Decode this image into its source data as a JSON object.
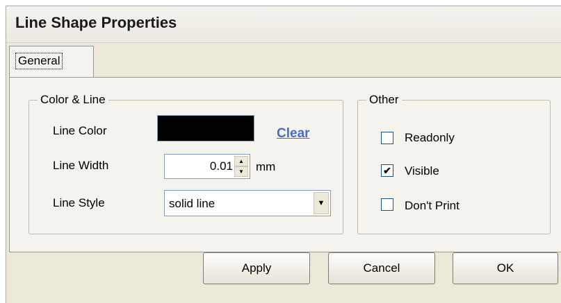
{
  "dialog": {
    "title": "Line Shape Properties"
  },
  "tabs": [
    {
      "label": "General",
      "selected": true
    }
  ],
  "color_line": {
    "legend": "Color & Line",
    "line_color_label": "Line Color",
    "line_color_value": "#000000",
    "clear_label": "Clear",
    "line_width_label": "Line Width",
    "line_width_value": "0.01",
    "line_width_unit": "mm",
    "line_style_label": "Line Style",
    "line_style_value": "solid line"
  },
  "other": {
    "legend": "Other",
    "options": [
      {
        "label": "Readonly",
        "checked": false
      },
      {
        "label": "Visible",
        "checked": true
      },
      {
        "label": "Don't Print",
        "checked": false
      }
    ]
  },
  "buttons": {
    "apply": "Apply",
    "cancel": "Cancel",
    "ok": "OK"
  },
  "icons": {
    "check": "✔",
    "spin_up": "▲",
    "spin_down": "▼",
    "dropdown": "▼"
  }
}
